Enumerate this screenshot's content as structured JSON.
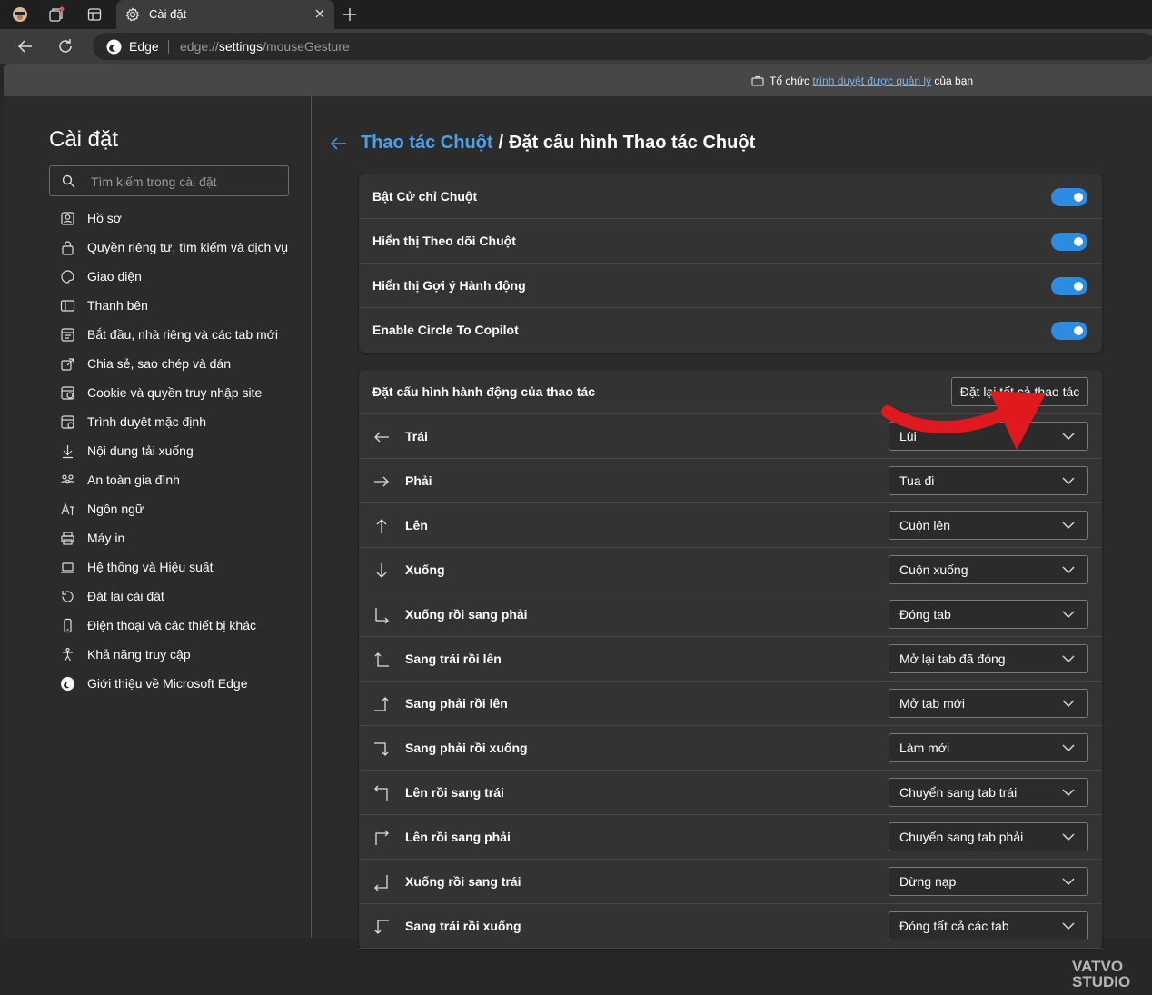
{
  "browser": {
    "tab_title": "Cài đặt",
    "site_name": "Edge",
    "url_prefix": "edge://",
    "url_main": "settings",
    "url_suffix": "/mouseGesture",
    "managed_prefix": "Tổ chức",
    "managed_link": "trình duyệt được quản lý",
    "managed_suffix": "của bạn"
  },
  "sidebar": {
    "title": "Cài đặt",
    "search_placeholder": "Tìm kiếm trong cài đặt",
    "items": [
      {
        "label": "Hồ sơ",
        "icon": "profile-icon"
      },
      {
        "label": "Quyền riêng tư, tìm kiếm và dịch vụ",
        "icon": "lock-icon"
      },
      {
        "label": "Giao diện",
        "icon": "palette-icon"
      },
      {
        "label": "Thanh bên",
        "icon": "sidebar-icon"
      },
      {
        "label": "Bắt đầu, nhà riêng và các tab mới",
        "icon": "start-page-icon"
      },
      {
        "label": "Chia sẻ, sao chép và dán",
        "icon": "share-icon"
      },
      {
        "label": "Cookie và quyền truy nhập site",
        "icon": "cookie-icon"
      },
      {
        "label": "Trình duyệt mặc định",
        "icon": "default-browser-icon"
      },
      {
        "label": "Nội dung tải xuống",
        "icon": "download-icon"
      },
      {
        "label": "An toàn gia đình",
        "icon": "family-icon"
      },
      {
        "label": "Ngôn ngữ",
        "icon": "language-icon"
      },
      {
        "label": "Máy in",
        "icon": "printer-icon"
      },
      {
        "label": "Hệ thống và Hiệu suất",
        "icon": "laptop-icon"
      },
      {
        "label": "Đặt lại cài đặt",
        "icon": "reset-icon"
      },
      {
        "label": "Điện thoại và các thiết bị khác",
        "icon": "phone-icon"
      },
      {
        "label": "Khả năng truy cập",
        "icon": "accessibility-icon"
      },
      {
        "label": "Giới thiệu về Microsoft Edge",
        "icon": "edge-icon"
      }
    ]
  },
  "main": {
    "breadcrumb_parent": "Thao tác Chuột",
    "breadcrumb_sep": "/",
    "breadcrumb_current": "Đặt cấu hình Thao tác Chuột",
    "toggles": [
      {
        "label": "Bật Cử chỉ Chuột",
        "on": true
      },
      {
        "label": "Hiển thị Theo dõi Chuột",
        "on": true
      },
      {
        "label": "Hiển thị Gợi ý Hành động",
        "on": true
      },
      {
        "label": "Enable Circle To Copilot",
        "on": true
      }
    ],
    "actions_header": "Đặt cấu hình hành động của thao tác",
    "reset_all_label": "Đặt lại tất cả thao tác",
    "gestures": [
      {
        "label": "Trái",
        "value": "Lùi",
        "icon": "arrow-left-icon"
      },
      {
        "label": "Phải",
        "value": "Tua đi",
        "icon": "arrow-right-icon"
      },
      {
        "label": "Lên",
        "value": "Cuộn lên",
        "icon": "arrow-up-icon"
      },
      {
        "label": "Xuống",
        "value": "Cuộn xuống",
        "icon": "arrow-down-icon"
      },
      {
        "label": "Xuống rồi sang phải",
        "value": "Đóng tab",
        "icon": "down-right-icon"
      },
      {
        "label": "Sang trái rồi lên",
        "value": "Mở lại tab đã đóng",
        "icon": "left-up-icon"
      },
      {
        "label": "Sang phải rồi lên",
        "value": "Mở tab mới",
        "icon": "right-up-icon"
      },
      {
        "label": "Sang phải rồi xuống",
        "value": "Làm mới",
        "icon": "right-down-icon"
      },
      {
        "label": "Lên rồi sang trái",
        "value": "Chuyển sang tab trái",
        "icon": "up-left-icon"
      },
      {
        "label": "Lên rồi sang phải",
        "value": "Chuyển sang tab phải",
        "icon": "up-right-icon"
      },
      {
        "label": "Xuống rồi sang trái",
        "value": "Dừng nạp",
        "icon": "down-left-icon"
      },
      {
        "label": "Sang trái rồi xuống",
        "value": "Đóng tất cả các tab",
        "icon": "left-down-icon"
      }
    ]
  },
  "watermark": {
    "line1": "VATVO",
    "line2": "STUDIO"
  },
  "colors": {
    "accent": "#2c8be3",
    "link": "#4ca0e8",
    "annotation_arrow": "#e0191e"
  }
}
